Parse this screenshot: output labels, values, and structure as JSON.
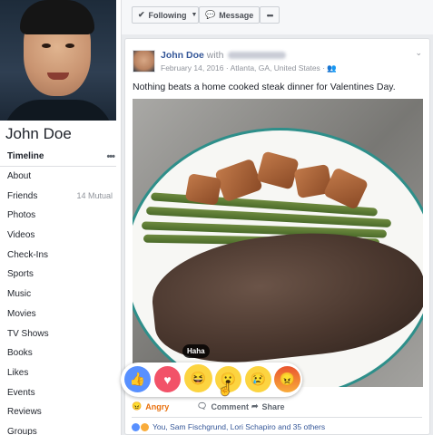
{
  "profile": {
    "name": "John Doe"
  },
  "nav": {
    "items": [
      {
        "label": "Timeline",
        "active": true,
        "extra": "•••"
      },
      {
        "label": "About"
      },
      {
        "label": "Friends",
        "extra": "14 Mutual"
      },
      {
        "label": "Photos"
      },
      {
        "label": "Videos"
      },
      {
        "label": "Check-Ins"
      },
      {
        "label": "Sports"
      },
      {
        "label": "Music"
      },
      {
        "label": "Movies"
      },
      {
        "label": "TV Shows"
      },
      {
        "label": "Books"
      },
      {
        "label": "Likes"
      },
      {
        "label": "Events"
      },
      {
        "label": "Reviews"
      },
      {
        "label": "Groups"
      }
    ]
  },
  "toolbar": {
    "following_label": "Following",
    "message_label": "Message",
    "more_label": "•••"
  },
  "post": {
    "author": "John Doe",
    "with_label": "with",
    "date": "February 14, 2016",
    "location": "Atlanta, GA, United States",
    "text": "Nothing beats a home cooked steak dinner for Valentines Day."
  },
  "reactions": {
    "tooltip": "Haha",
    "icons": [
      "like-icon",
      "love-icon",
      "haha-icon",
      "wow-icon",
      "sad-icon",
      "angry-icon"
    ]
  },
  "actions": {
    "angry_label": "Angry",
    "comment_label": "Comment",
    "share_label": "Share"
  },
  "summary": {
    "text": "You, Sam Fischgrund, Lori Schapiro and 35 others"
  },
  "colors": {
    "link": "#365899",
    "angry": "#e9710f",
    "like": "#5890ff",
    "love": "#f25268",
    "yellow": "#fcd440"
  }
}
